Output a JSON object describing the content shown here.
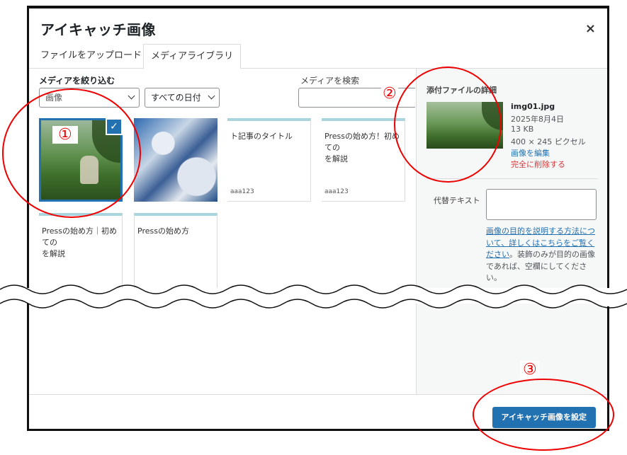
{
  "modal": {
    "title": "アイキャッチ画像",
    "close_label": "×",
    "tabs": [
      "ファイルをアップロード",
      "メディアライブラリ"
    ]
  },
  "toolbar": {
    "filter_label": "メディアを絞り込む",
    "type_filter_value": "画像",
    "date_filter_value": "すべての日付",
    "search_label": "メディアを検索"
  },
  "library": {
    "posts": [
      {
        "title": "ト記事のタイトル",
        "author": "aaa123"
      },
      {
        "title": "Pressの始め方！初めての\nを解説",
        "author": "aaa123"
      },
      {
        "title": "Pressの始め方｜初めての\nを解説",
        "author": ""
      },
      {
        "title": "Pressの始め方",
        "author": ""
      }
    ]
  },
  "details": {
    "heading": "添付ファイルの詳細",
    "filename": "img01.jpg",
    "date": "2025年8月4日",
    "size": "13 KB",
    "dimensions": "400 × 245 ピクセル",
    "edit_link": "画像を編集",
    "delete_link": "完全に削除する",
    "alt_label": "代替テキスト",
    "help_link": "画像の目的を説明する方法について、詳しくはこちらをご覧ください",
    "help_text": "。装飾のみが目的の画像であれば、空欄にしてください。"
  },
  "footer": {
    "set_button": "アイキャッチ画像を設定"
  },
  "annotations": {
    "n1": "①",
    "n2": "②",
    "n3": "③"
  },
  "colors": {
    "accent": "#2271b1",
    "annotation": "#e00000",
    "delete": "#d63638"
  }
}
